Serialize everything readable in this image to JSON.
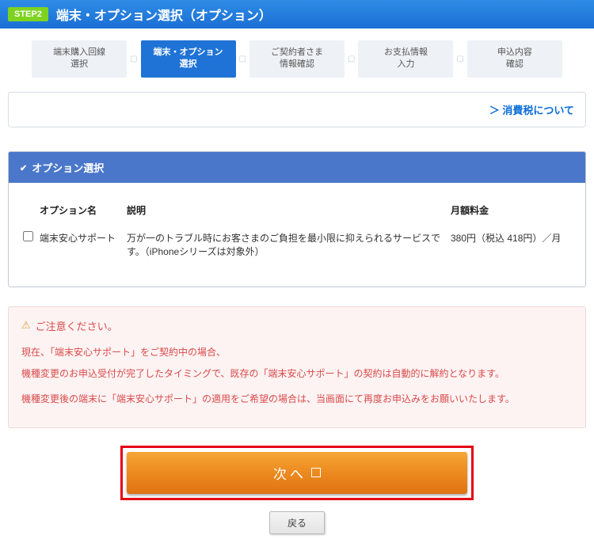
{
  "header": {
    "step_badge": "STEP2",
    "title": "端末・オプション選択（オプション）"
  },
  "steps": [
    {
      "l1": "端末購入回線",
      "l2": "選択"
    },
    {
      "l1": "端末・オプション",
      "l2": "選択"
    },
    {
      "l1": "ご契約者さま",
      "l2": "情報確認"
    },
    {
      "l1": "お支払情報",
      "l2": "入力"
    },
    {
      "l1": "申込内容",
      "l2": "確認"
    }
  ],
  "tax_link": "＞ 消費税について",
  "panel": {
    "title": "オプション選択",
    "columns": {
      "name": "オプション名",
      "desc": "説明",
      "price": "月額料金"
    },
    "rows": [
      {
        "name": "端末安心サポート",
        "desc": "万が一のトラブル時にお客さまのご負担を最小限に抑えられるサービスです。（iPhoneシリーズは対象外）",
        "price": "380円（税込 418円）／月"
      }
    ]
  },
  "notice": {
    "title": "ご注意ください。",
    "p1": "現在、「端末安心サポート」をご契約中の場合、",
    "p2": "機種変更のお申込受付が完了したタイミングで、既存の「端末安心サポート」の契約は自動的に解約となります。",
    "p3": "機種変更後の端末に「端末安心サポート」の適用をご希望の場合は、当画面にて再度お申込みをお願いいたします。"
  },
  "buttons": {
    "next": "次へ",
    "back": "戻る"
  }
}
